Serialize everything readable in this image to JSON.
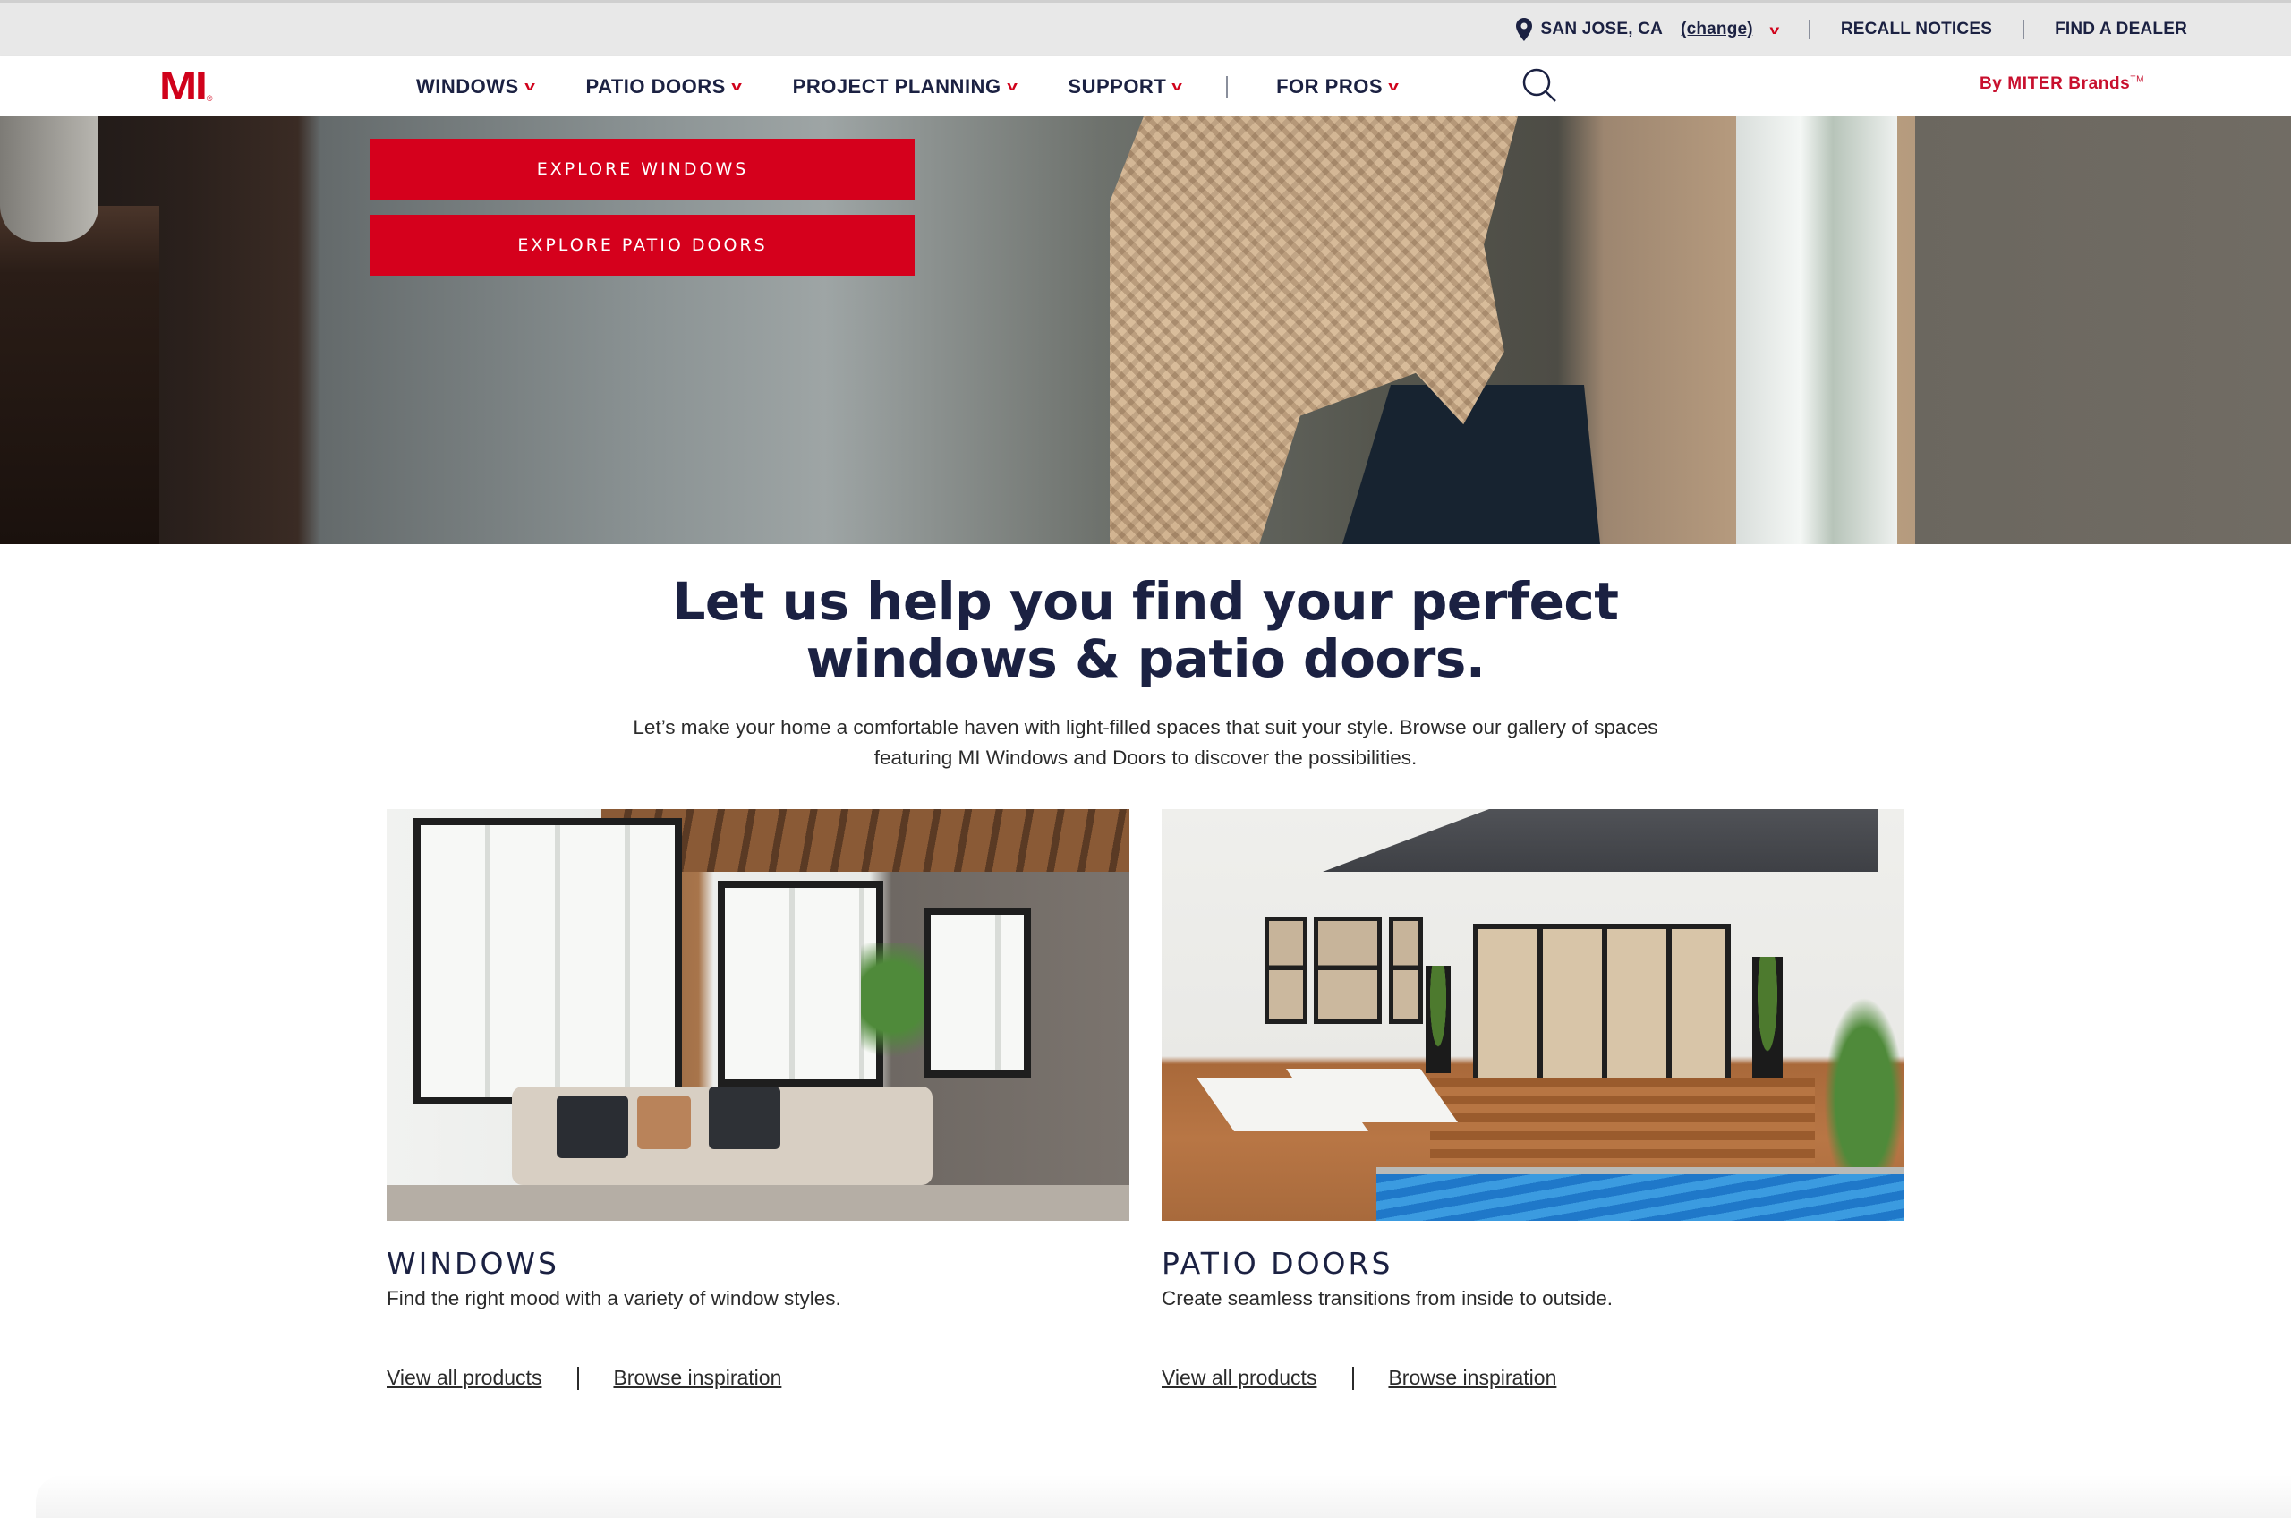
{
  "utility_bar": {
    "location_icon": "map-pin-icon",
    "location": "SAN JOSE, CA",
    "change_label": "(change)",
    "recall_notices": "RECALL NOTICES",
    "find_dealer": "FIND A DEALER"
  },
  "nav": {
    "logo": "MI",
    "logo_mark": "®",
    "items": [
      {
        "label": "WINDOWS"
      },
      {
        "label": "PATIO DOORS"
      },
      {
        "label": "PROJECT PLANNING"
      },
      {
        "label": "SUPPORT"
      },
      {
        "label": "FOR PROS"
      }
    ],
    "search_icon": "search-icon",
    "by_brand": "By MITER Brands",
    "by_brand_tm": "TM"
  },
  "hero": {
    "buttons": [
      {
        "label": "EXPLORE WINDOWS"
      },
      {
        "label": "EXPLORE PATIO DOORS"
      }
    ]
  },
  "intro": {
    "title_line1": "Let us help you find your perfect",
    "title_line2": "windows & patio doors.",
    "body": "Let’s make your home a comfortable haven with light-filled spaces that suit your style. Browse our gallery of spaces featuring MI Windows and Doors to discover the possibilities."
  },
  "cards": [
    {
      "title": "WINDOWS",
      "description": "Find the right mood with a variety of window styles.",
      "link_products": "View all products",
      "link_inspiration": "Browse inspiration"
    },
    {
      "title": "PATIO DOORS",
      "description": "Create seamless transitions from inside to outside.",
      "link_products": "View all products",
      "link_inspiration": "Browse inspiration"
    }
  ],
  "colors": {
    "brand_red": "#d5001c",
    "navy": "#1b2142",
    "utility_bg": "#e8e8e8"
  }
}
